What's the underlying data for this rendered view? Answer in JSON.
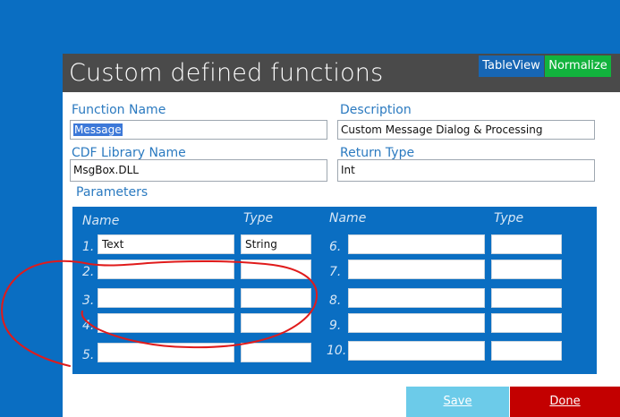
{
  "dialog": {
    "title": "Custom defined functions",
    "buttons": {
      "tableview": "TableView",
      "normalize": "Normalize"
    }
  },
  "fields": {
    "function_name": {
      "label": "Function Name",
      "value": "Message"
    },
    "description": {
      "label": "Description",
      "value": "Custom Message Dialog & Processing"
    },
    "cdf_library": {
      "label": "CDF Library Name",
      "value": "MsgBox.DLL"
    },
    "return_type": {
      "label": "Return Type",
      "value": "Int"
    }
  },
  "parameters": {
    "label": "Parameters",
    "headers": {
      "name": "Name",
      "type": "Type"
    },
    "rows": [
      {
        "num": "1.",
        "name": "Text",
        "type": "String"
      },
      {
        "num": "2.",
        "name": "",
        "type": ""
      },
      {
        "num": "3.",
        "name": "",
        "type": ""
      },
      {
        "num": "4.",
        "name": "",
        "type": ""
      },
      {
        "num": "5.",
        "name": "",
        "type": ""
      },
      {
        "num": "6.",
        "name": "",
        "type": ""
      },
      {
        "num": "7.",
        "name": "",
        "type": ""
      },
      {
        "num": "8.",
        "name": "",
        "type": ""
      },
      {
        "num": "9.",
        "name": "",
        "type": ""
      },
      {
        "num": "10.",
        "name": "",
        "type": ""
      }
    ]
  },
  "footer": {
    "save": "Save",
    "done": "Done"
  },
  "annotation": {
    "color": "#e01b1b",
    "shape": "hand-drawn-ellipse"
  }
}
